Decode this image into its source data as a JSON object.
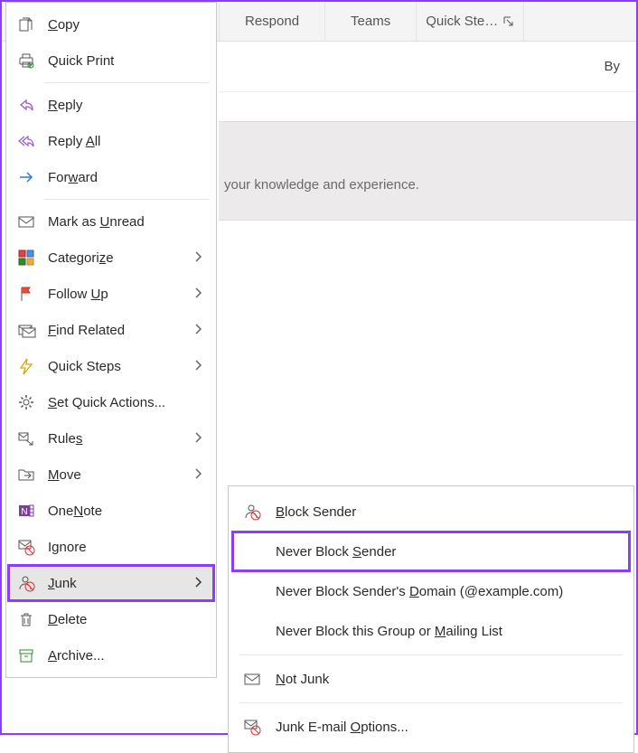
{
  "ribbon": {
    "groups": [
      "Respond",
      "Teams",
      "Quick Ste…"
    ]
  },
  "header": {
    "by": "By"
  },
  "banner": {
    "text_fragment": "your knowledge and experience."
  },
  "menu": {
    "copy": "Copy",
    "quick_print": "Quick Print",
    "reply": "Reply",
    "reply_all": "Reply All",
    "forward": "Forward",
    "mark_unread": "Mark as Unread",
    "categorize": "Categorize",
    "follow_up": "Follow Up",
    "find_related": "Find Related",
    "quick_steps": "Quick Steps",
    "set_quick_actions": "Set Quick Actions...",
    "rules": "Rules",
    "move": "Move",
    "onenote": "OneNote",
    "ignore": "Ignore",
    "junk": "Junk",
    "delete": "Delete",
    "archive": "Archive..."
  },
  "submenu": {
    "block_sender": "Block Sender",
    "never_block_sender": "Never Block Sender",
    "never_block_domain": "Never Block Sender's Domain (@example.com)",
    "never_block_group": "Never Block this Group or Mailing List",
    "not_junk": "Not Junk",
    "junk_options": "Junk E-mail Options..."
  }
}
